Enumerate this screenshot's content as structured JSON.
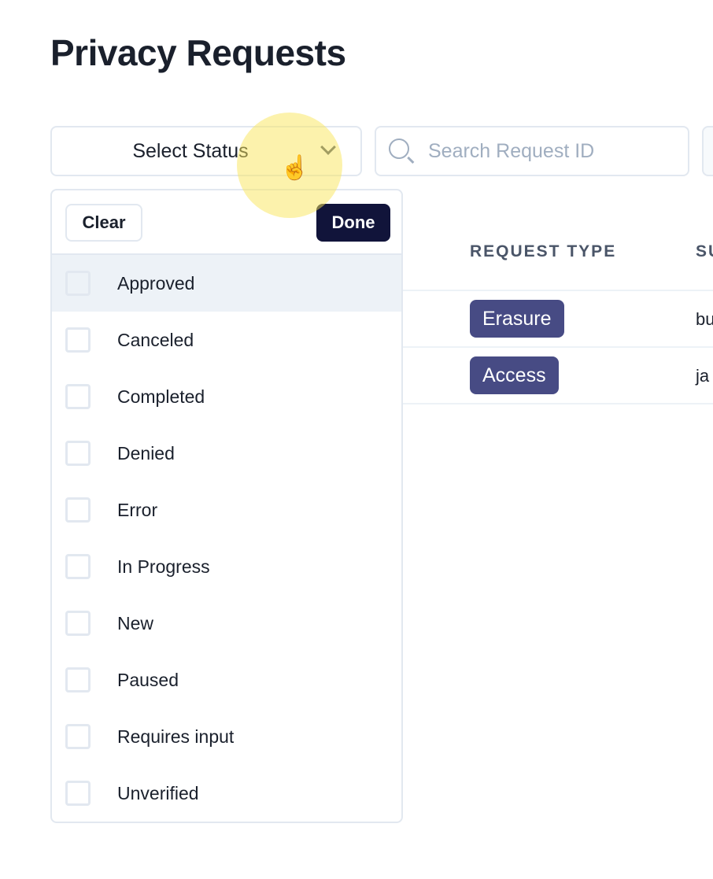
{
  "page_title": "Privacy Requests",
  "status_select": {
    "label": "Select Status"
  },
  "search": {
    "placeholder": "Search Request ID"
  },
  "table": {
    "headers": [
      "REQUEST TYPE",
      "SU"
    ],
    "rows": [
      {
        "type": "Erasure",
        "subject": "bu"
      },
      {
        "type": "Access",
        "subject": "ja"
      }
    ]
  },
  "dropdown": {
    "clear_label": "Clear",
    "done_label": "Done",
    "options": [
      "Approved",
      "Canceled",
      "Completed",
      "Denied",
      "Error",
      "In Progress",
      "New",
      "Paused",
      "Requires input",
      "Unverified"
    ],
    "highlighted": "Approved"
  },
  "colors": {
    "badge": "#474b84",
    "done_button": "#11143a",
    "highlight": "#edf2f7"
  }
}
